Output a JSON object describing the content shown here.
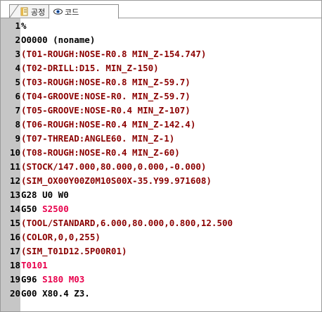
{
  "tabs": [
    {
      "label": "공정",
      "icon": "document-icon",
      "active": false
    },
    {
      "label": "코드",
      "icon": "eye-icon",
      "active": true
    }
  ],
  "colors": {
    "gutter": "#c6c6c6",
    "comment": "#8b0000",
    "normal": "#000000",
    "highlight": "#e8004c"
  },
  "lines": [
    {
      "n": "1",
      "segments": [
        {
          "t": "%",
          "k": "normal"
        }
      ]
    },
    {
      "n": "2",
      "segments": [
        {
          "t": "O0000 (noname)",
          "k": "normal"
        }
      ]
    },
    {
      "n": "3",
      "segments": [
        {
          "t": "(T01-ROUGH:NOSE-R0.8 MIN_Z-154.747)",
          "k": "comment"
        }
      ]
    },
    {
      "n": "4",
      "segments": [
        {
          "t": "(T02-DRILL:D15. MIN_Z-150)",
          "k": "comment"
        }
      ]
    },
    {
      "n": "5",
      "segments": [
        {
          "t": "(T03-ROUGH:NOSE-R0.8 MIN_Z-59.7)",
          "k": "comment"
        }
      ]
    },
    {
      "n": "6",
      "segments": [
        {
          "t": "(T04-GROOVE:NOSE-R0. MIN_Z-59.7)",
          "k": "comment"
        }
      ]
    },
    {
      "n": "7",
      "segments": [
        {
          "t": "(T05-GROOVE:NOSE-R0.4 MIN_Z-107)",
          "k": "comment"
        }
      ]
    },
    {
      "n": "8",
      "segments": [
        {
          "t": "(T06-ROUGH:NOSE-R0.4 MIN_Z-142.4)",
          "k": "comment"
        }
      ]
    },
    {
      "n": "9",
      "segments": [
        {
          "t": "(T07-THREAD:ANGLE60. MIN_Z-1)",
          "k": "comment"
        }
      ]
    },
    {
      "n": "10",
      "segments": [
        {
          "t": "(T08-ROUGH:NOSE-R0.4 MIN_Z-60)",
          "k": "comment"
        }
      ]
    },
    {
      "n": "11",
      "segments": [
        {
          "t": "(STOCK/147.000,80.000,0.000,-0.000)",
          "k": "comment"
        }
      ]
    },
    {
      "n": "12",
      "segments": [
        {
          "t": "(SIM_OX00Y00Z0M10S00X-35.Y99.971608)",
          "k": "comment"
        }
      ]
    },
    {
      "n": "13",
      "segments": [
        {
          "t": "G28 U0 W0",
          "k": "normal"
        }
      ]
    },
    {
      "n": "14",
      "segments": [
        {
          "t": "G50 ",
          "k": "normal"
        },
        {
          "t": "S2500",
          "k": "s"
        }
      ]
    },
    {
      "n": "15",
      "segments": [
        {
          "t": "(TOOL/STANDARD,6.000,80.000,0.800,12.500",
          "k": "comment"
        }
      ]
    },
    {
      "n": "16",
      "segments": [
        {
          "t": "(COLOR,0,0,255)",
          "k": "comment"
        }
      ]
    },
    {
      "n": "17",
      "segments": [
        {
          "t": "(SIM_T01D12.5P00R01)",
          "k": "comment"
        }
      ]
    },
    {
      "n": "18",
      "segments": [
        {
          "t": "T0101",
          "k": "t"
        }
      ]
    },
    {
      "n": "19",
      "segments": [
        {
          "t": "G96 ",
          "k": "normal"
        },
        {
          "t": "S180 M03",
          "k": "s"
        }
      ]
    },
    {
      "n": "20",
      "segments": [
        {
          "t": "G00 X80.4 Z3.",
          "k": "normal"
        }
      ]
    }
  ]
}
